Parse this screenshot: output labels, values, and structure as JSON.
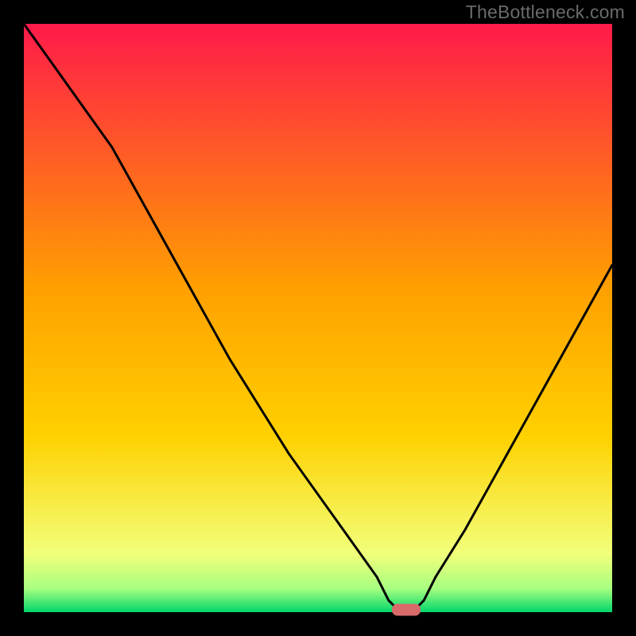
{
  "watermark": {
    "text": "TheBottleneck.com"
  },
  "chart_data": {
    "type": "line",
    "title": "",
    "xlabel": "",
    "ylabel": "",
    "xlim": [
      0,
      100
    ],
    "ylim": [
      0,
      100
    ],
    "x": [
      0,
      5,
      10,
      15,
      20,
      25,
      30,
      35,
      40,
      45,
      50,
      55,
      60,
      62,
      64,
      66,
      68,
      70,
      75,
      80,
      85,
      90,
      95,
      100
    ],
    "values": [
      100,
      93,
      86,
      79,
      70,
      61,
      52,
      43,
      35,
      27,
      20,
      13,
      6,
      2,
      0,
      0,
      2,
      6,
      14,
      23,
      32,
      41,
      50,
      59
    ],
    "gradient": {
      "top_color": "#ff1a4a",
      "mid_color": "#ffd100",
      "low_color": "#f2ff7a",
      "bottom_color": "#00d66b"
    },
    "optimal_x": 65,
    "marker_color": "#d96a6a"
  }
}
